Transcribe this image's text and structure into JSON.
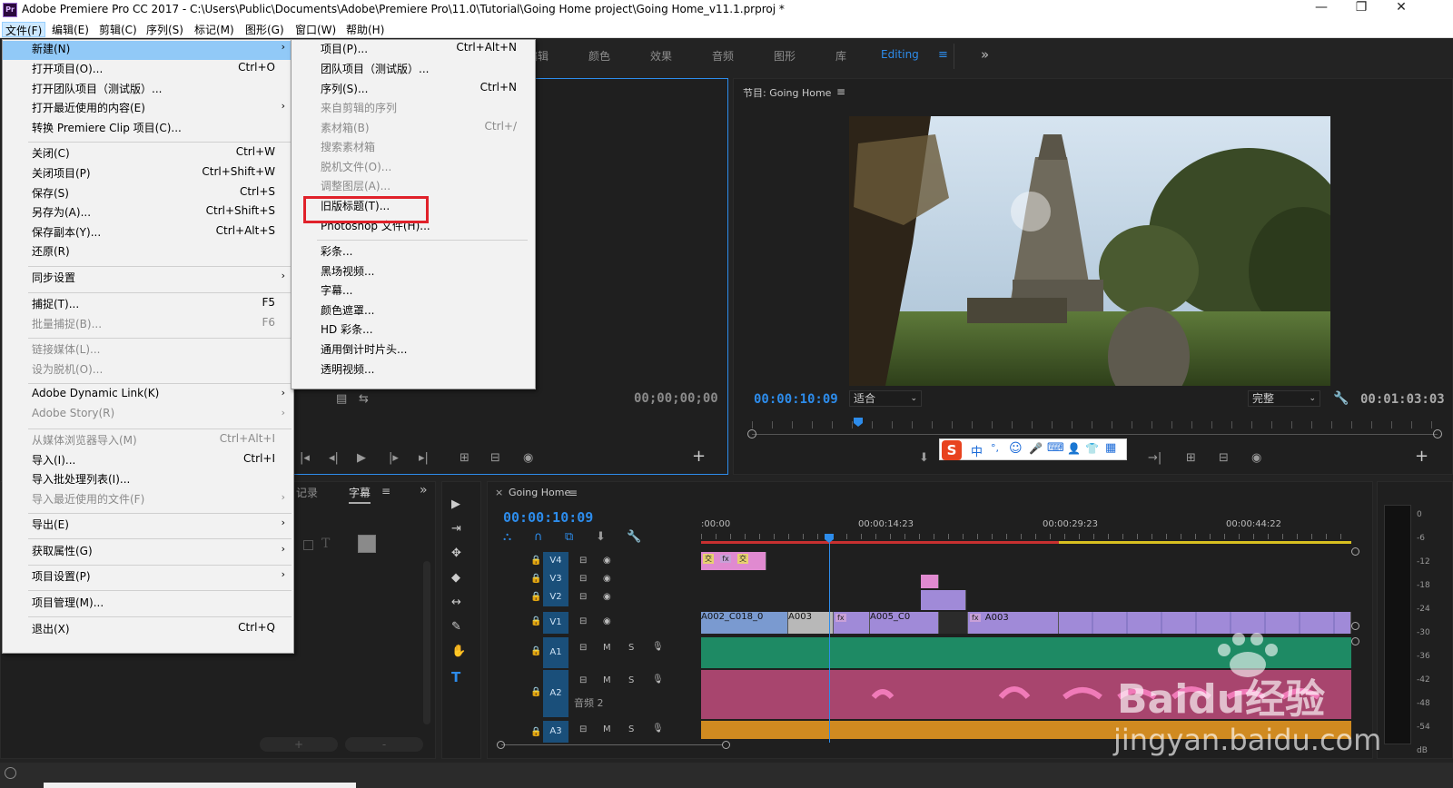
{
  "window": {
    "title": "Adobe Premiere Pro CC 2017 - C:\\Users\\Public\\Documents\\Adobe\\Premiere Pro\\11.0\\Tutorial\\Going Home project\\Going Home_v11.1.prproj *",
    "app_icon": "Pr",
    "minimize": "—",
    "maximize": "❐",
    "close": "✕"
  },
  "menubar": [
    "文件(F)",
    "编辑(E)",
    "剪辑(C)",
    "序列(S)",
    "标记(M)",
    "图形(G)",
    "窗口(W)",
    "帮助(H)"
  ],
  "workspaces": {
    "tabs": [
      "编辑",
      "颜色",
      "效果",
      "音频",
      "图形",
      "库",
      "Editing"
    ],
    "active": "Editing",
    "menu_glyph": "≡",
    "more_glyph": "»"
  },
  "file_menu": {
    "items": [
      {
        "label": "新建(N)",
        "submenu": true,
        "highlight": true
      },
      {
        "label": "打开项目(O)...",
        "shortcut": "Ctrl+O"
      },
      {
        "label": "打开团队项目（测试版）..."
      },
      {
        "label": "打开最近使用的内容(E)",
        "submenu": true
      },
      {
        "label": "转换 Premiere Clip 项目(C)..."
      },
      {
        "label": "关闭(C)",
        "shortcut": "Ctrl+W"
      },
      {
        "label": "关闭项目(P)",
        "shortcut": "Ctrl+Shift+W"
      },
      {
        "label": "保存(S)",
        "shortcut": "Ctrl+S"
      },
      {
        "label": "另存为(A)...",
        "shortcut": "Ctrl+Shift+S"
      },
      {
        "label": "保存副本(Y)...",
        "shortcut": "Ctrl+Alt+S"
      },
      {
        "label": "还原(R)"
      },
      {
        "label": "同步设置",
        "submenu": true
      },
      {
        "label": "捕捉(T)...",
        "shortcut": "F5"
      },
      {
        "label": "批量捕捉(B)...",
        "shortcut": "F6",
        "disabled": true
      },
      {
        "label": "链接媒体(L)...",
        "disabled": true
      },
      {
        "label": "设为脱机(O)...",
        "disabled": true
      },
      {
        "label": "Adobe Dynamic Link(K)",
        "submenu": true
      },
      {
        "label": "Adobe Story(R)",
        "submenu": true,
        "disabled": true
      },
      {
        "label": "从媒体浏览器导入(M)",
        "shortcut": "Ctrl+Alt+I",
        "disabled": true
      },
      {
        "label": "导入(I)...",
        "shortcut": "Ctrl+I"
      },
      {
        "label": "导入批处理列表(I)..."
      },
      {
        "label": "导入最近使用的文件(F)",
        "submenu": true,
        "disabled": true
      },
      {
        "label": "导出(E)",
        "submenu": true
      },
      {
        "label": "获取属性(G)",
        "submenu": true
      },
      {
        "label": "项目设置(P)",
        "submenu": true
      },
      {
        "label": "项目管理(M)..."
      },
      {
        "label": "退出(X)",
        "shortcut": "Ctrl+Q"
      }
    ]
  },
  "new_menu": {
    "items": [
      {
        "label": "项目(P)...",
        "shortcut": "Ctrl+Alt+N"
      },
      {
        "label": "团队项目（测试版）..."
      },
      {
        "label": "序列(S)...",
        "shortcut": "Ctrl+N"
      },
      {
        "label": "来自剪辑的序列",
        "disabled": true
      },
      {
        "label": "素材箱(B)",
        "shortcut": "Ctrl+/",
        "disabled": true
      },
      {
        "label": "搜索素材箱",
        "disabled": true
      },
      {
        "label": "脱机文件(O)...",
        "disabled": true
      },
      {
        "label": "调整图层(A)...",
        "disabled": true
      },
      {
        "label": "旧版标题(T)...",
        "highlight_box": true
      },
      {
        "label": "Photoshop 文件(H)..."
      },
      {
        "label": "彩条..."
      },
      {
        "label": "黑场视频..."
      },
      {
        "label": "字幕..."
      },
      {
        "label": "颜色遮罩..."
      },
      {
        "label": "HD 彩条..."
      },
      {
        "label": "通用倒计时片头..."
      },
      {
        "label": "透明视频..."
      }
    ]
  },
  "source_monitor": {
    "timecode": "00;00;00;00",
    "add_glyph": "+"
  },
  "program_monitor": {
    "title": "节目: Going Home",
    "menu_glyph": "≡",
    "timecode_current": "00:00:10:09",
    "fit": "适合",
    "quality": "完整",
    "timecode_duration": "00:01:03:03",
    "add_glyph": "+"
  },
  "ime_toolbar": [
    "S",
    "中",
    "°,",
    "☺",
    "🎤",
    "⌨",
    "👤",
    "👕",
    "▦"
  ],
  "left_panel": {
    "tabs": [
      "记录",
      "字幕"
    ],
    "menu_glyph": "≡",
    "more_glyph": "»",
    "letter_t": "T",
    "plus": "+",
    "minus": "-"
  },
  "tools": [
    "▶",
    "⇥",
    "✥",
    "◆",
    "↔",
    "✎",
    "✋",
    "T"
  ],
  "timeline": {
    "close_glyph": "×",
    "sequence_name": "Going Home",
    "menu_glyph": "≡",
    "timecode": "00:00:10:09",
    "ruler": [
      ":00:00",
      "00:00:14:23",
      "00:00:29:23",
      "00:00:44:22"
    ],
    "video_tracks": [
      "V4",
      "V3",
      "V2",
      "V1"
    ],
    "audio_tracks": [
      "A1",
      "A2",
      "A3"
    ],
    "audio_track_name": "音频 2",
    "mute": "M",
    "solo": "S",
    "clip_labels": [
      "交",
      "fx",
      "交",
      "A002_C018_0",
      "A003",
      "fx",
      "A005_C0",
      "fx",
      "A003"
    ]
  },
  "audio_meter": {
    "ticks": [
      "0",
      "-6",
      "-12",
      "-18",
      "-24",
      "-30",
      "-36",
      "-42",
      "-48",
      "-54",
      "dB"
    ]
  },
  "watermark": {
    "brand": "Baidu经验",
    "url": "jingyan.baidu.com"
  },
  "colors": {
    "accent_blue": "#2d8ceb",
    "menu_highlight": "#91c9f7",
    "red_box": "#e0212a",
    "clip_pink": "#e08ad0",
    "clip_purple": "#a08ad8",
    "clip_blue": "#7a9ad0",
    "audio_green": "#1e8a64",
    "audio_pink": "#a8456e",
    "audio_orange": "#d08a20"
  }
}
